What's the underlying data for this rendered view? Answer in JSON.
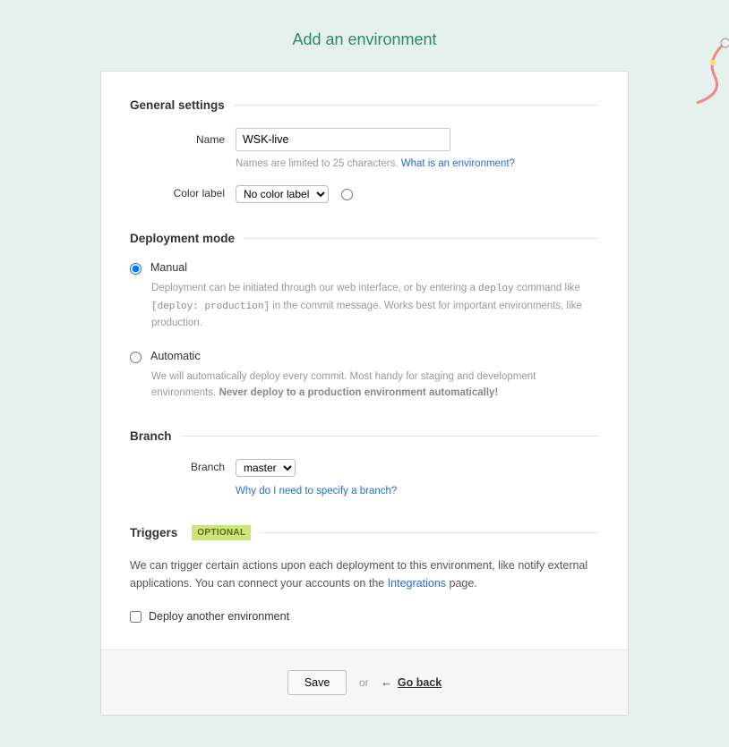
{
  "page": {
    "title": "Add an environment"
  },
  "general": {
    "heading": "General settings",
    "name_label": "Name",
    "name_value": "WSK-live",
    "name_help": "Names are limited to 25 characters.",
    "name_help_link": "What is an environment?",
    "color_label": "Color label",
    "color_select": "No color label"
  },
  "deployment": {
    "heading": "Deployment mode",
    "manual": {
      "label": "Manual",
      "desc_pre": "Deployment can be initiated through our web interface, or by entering a ",
      "code1": "deploy",
      "desc_mid": " command like ",
      "code2": "[deploy: production]",
      "desc_post": " in the commit message. Works best for important environments, like production."
    },
    "automatic": {
      "label": "Automatic",
      "desc_pre": "We will automatically deploy every commit. Most handy for staging and development environments. ",
      "desc_strong": "Never deploy to a production environment automatically!"
    }
  },
  "branch": {
    "heading": "Branch",
    "label": "Branch",
    "select": "master",
    "help_link": "Why do I need to specify a branch?"
  },
  "triggers": {
    "heading": "Triggers",
    "badge": "OPTIONAL",
    "desc_pre": "We can trigger certain actions upon each deployment to this environment, like notify external applications. You can connect your accounts on the ",
    "desc_link": "Integrations",
    "desc_post": " page.",
    "checkbox_label": "Deploy another environment"
  },
  "footer": {
    "save": "Save",
    "or": "or",
    "arrow": "←",
    "go_back": "Go back"
  }
}
